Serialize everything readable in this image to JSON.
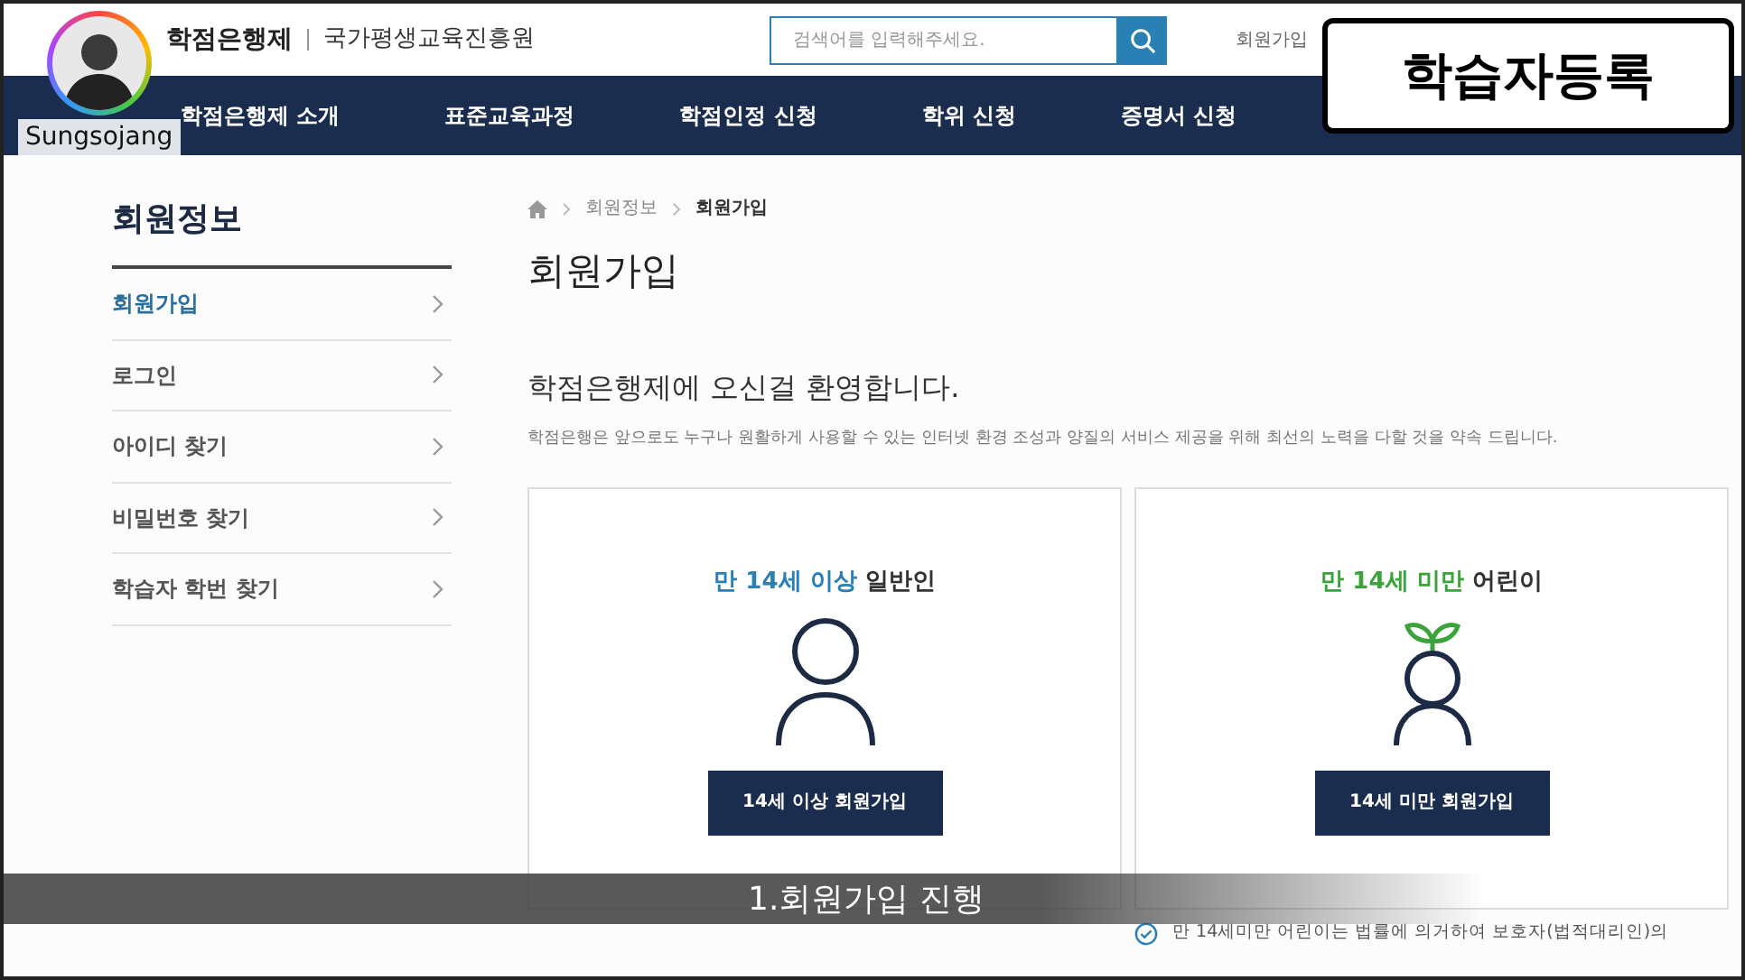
{
  "header": {
    "logo": "학점은행제",
    "org": "국가평생교육진흥원",
    "search": {
      "placeholder": "검색어를 입력해주세요."
    },
    "links": [
      "회원가입"
    ]
  },
  "nav": [
    "학점은행제 소개",
    "표준교육과정",
    "학점인정 신청",
    "학위 신청",
    "증명서 신청"
  ],
  "sidebar": {
    "title": "회원정보",
    "items": [
      {
        "label": "회원가입",
        "selected": true
      },
      {
        "label": "로그인",
        "selected": false
      },
      {
        "label": "아이디 찾기",
        "selected": false
      },
      {
        "label": "비밀번호 찾기",
        "selected": false
      },
      {
        "label": "학습자 학번 찾기",
        "selected": false
      }
    ]
  },
  "breadcrumb": [
    "회원정보",
    "회원가입"
  ],
  "page_title": "회원가입",
  "welcome": {
    "heading": "학점은행제에 오신걸 환영합니다.",
    "text": "학점은행은 앞으로도 누구나 원활하게 사용할 수 있는 인터넷 환경 조성과 양질의 서비스 제공을 위해 최선의 노력을 다할 것을 약속 드립니다."
  },
  "cards": [
    {
      "kind": "adult",
      "highlight": "만 14세 이상",
      "rest": "일반인",
      "color": "#2a7fb5",
      "button": "14세 이상 회원가입"
    },
    {
      "kind": "child",
      "highlight": "만 14세 미만",
      "rest": "어린이",
      "color": "#3aa33a",
      "button": "14세 미만 회원가입"
    }
  ],
  "note": "만 14세미만 어린이는 법률에 의거하여 보호자(법적대리인)의",
  "video_overlay": {
    "channel": "Sungsojang",
    "title": "학습자등록",
    "subtitle": "1.회원가입 진행"
  }
}
